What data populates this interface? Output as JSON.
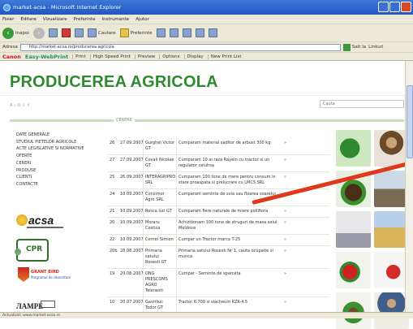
{
  "window": {
    "title": "market-acsa - Microsoft Internet Explorer"
  },
  "menu": [
    "Fisier",
    "Editare",
    "Vizualizare",
    "Preferinte",
    "Instrumente",
    "Ajutor"
  ],
  "toolbar": {
    "back": "Inapoi",
    "search": "Cautare",
    "favorites": "Preferinte"
  },
  "address": {
    "label": "Adresa",
    "url": "http://market-acsa.ro/producerea-agricola",
    "go": "Salt la",
    "links": "Linkuri"
  },
  "linksbar": {
    "canon": "Canon",
    "webprint": "Easy-WebPrint",
    "print": "Print",
    "high_speed": "High Speed Print",
    "preview": "Preview",
    "options": "Options",
    "display": "Display",
    "new_print_list": "New Print List"
  },
  "site": {
    "title": "PRODUCEREA AGRICOLA",
    "search_placeholder": "Cauta",
    "breadcrumb": "CERERE",
    "small_icons": "A  ⌕  ✉  ⇓  ⇑"
  },
  "sidenav": [
    "DATE GENERALE",
    "STUDIUL PIETELOR AGRICOLE",
    "ACTE LEGISLATIVE SI NORMATIVE",
    "OFERTE",
    "CERERI",
    "PRODUSE",
    "CLIENTI",
    "CONTACTE"
  ],
  "logos": {
    "acsa": "acsa",
    "cpr": "CPR",
    "gb_title": "GRANT BIRD",
    "gb_sub": "Programul de dezvoltare",
    "last": "ЛАМРЕ"
  },
  "rows": [
    {
      "id": "26",
      "date": "27.09.2007",
      "name": "Gurghel Victor GT",
      "text": "Cumparam material saditor de arbust 300 kg",
      "mark": "»"
    },
    {
      "id": "27",
      "date": "27.09.2007",
      "name": "Covali Nicolae GT",
      "text": "Cumparam 10 ai raza Rayeln cu tractor si un regulator celulrsa",
      "mark": "»"
    },
    {
      "id": "25",
      "date": "26.09.2007",
      "name": "INTERAGRIPRO SRL",
      "text": "Cumparam 100 tone de mere pentru consum in stare proaspata si prelucrare cu LMCS SRL",
      "mark": "»"
    },
    {
      "id": "24",
      "date": "10.09.2007",
      "name": "Consimor Agro SRL",
      "text": "Cumparam seminte de soia sau floarea soarelui",
      "mark": "»"
    },
    {
      "id": "21",
      "date": "10.09.2007",
      "name": "Rosca Iuri GT",
      "text": "Cumparam fiere naturale de miere pollifiora",
      "mark": "»"
    },
    {
      "id": "20",
      "date": "10.09.2007",
      "name": "Moraru Costica",
      "text": "Achizitionam 100 tone de struguri de masa soiul Moldova",
      "mark": "»"
    },
    {
      "id": "22",
      "date": "10.09.2007",
      "name": "Cernei Simion",
      "text": "Cumpar un Tractor marca T-25",
      "mark": "»"
    },
    {
      "id": "20b",
      "date": "28.08.2007",
      "name": "Primaria satului Rosesti GT",
      "text": "Primaria satului Rosesti Nr 1, cauta ocupatie si munca",
      "mark": "»"
    },
    {
      "id": "19",
      "date": "20.08.2007",
      "name": "ONG PRESCOMS AGRO Telenesti",
      "text": "Cumpar - Seminte de sparceta",
      "mark": "»"
    },
    {
      "id": "10",
      "date": "20.07.2007",
      "name": "Gavriliuc Todor GT",
      "text": "Tractor K-700 si slacheum KZK-4.5",
      "mark": "»"
    }
  ],
  "status": "Actualizat: www.market-acsa.ro"
}
